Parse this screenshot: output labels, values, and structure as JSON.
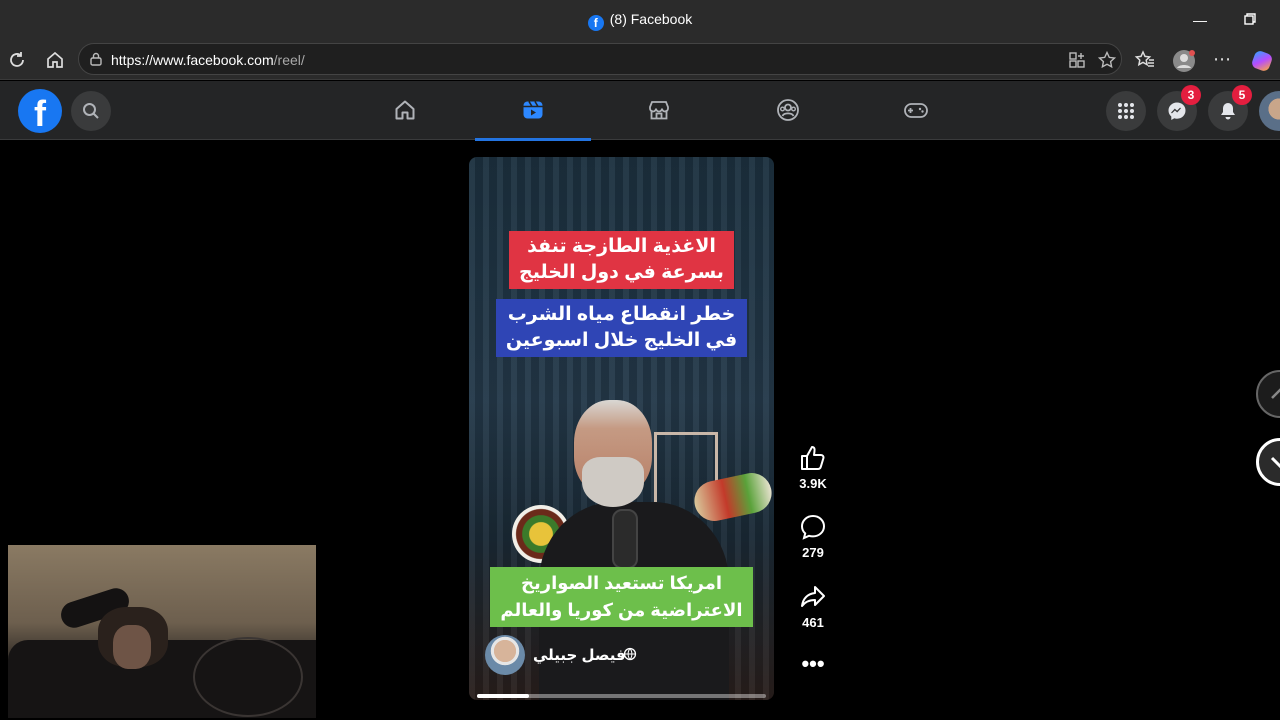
{
  "browser": {
    "tab_title": "(8) Facebook",
    "url_host": "https://www.facebook.com",
    "url_path": "/reel/"
  },
  "facebook": {
    "logo": "f",
    "nav_tabs": [
      {
        "name": "home-icon",
        "active": false
      },
      {
        "name": "reels-icon",
        "active": true
      },
      {
        "name": "marketplace-icon",
        "active": false
      },
      {
        "name": "groups-icon",
        "active": false
      },
      {
        "name": "gaming-icon",
        "active": false
      }
    ],
    "messenger_badge": "3",
    "notifications_badge": "5"
  },
  "reel": {
    "caption_1_line1": "الاغذية الطازجة تنفذ",
    "caption_1_line2": "بسرعة في دول الخليج",
    "caption_2_line1": "خطر انقطاع مياه الشرب",
    "caption_2_line2": "في الخليج خلال اسبوعين",
    "caption_3_line1": "امريكا تستعيد الصواريخ",
    "caption_3_line2": "الاعتراضية من كوريا والعالم",
    "author_name": "فيصل جبيلي",
    "progress": 0.18
  },
  "actions": {
    "likes": "3.9K",
    "comments": "279",
    "shares": "461"
  },
  "colors": {
    "accent": "#1877f2",
    "badge": "#e41e3f",
    "caption_red": "#e03443",
    "caption_blue": "#2f45b5",
    "caption_green": "#6dbf4b"
  }
}
